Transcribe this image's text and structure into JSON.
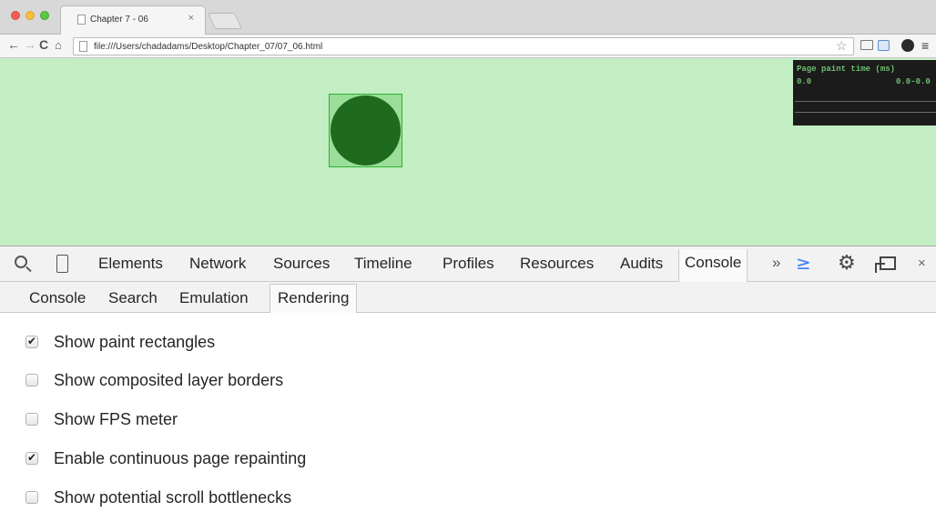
{
  "browser": {
    "tab_title": "Chapter 7 - 06",
    "tab_close": "×",
    "url": "file:///Users/chadadams/Desktop/Chapter_07/07_06.html",
    "nav": {
      "back": "←",
      "forward": "→",
      "reload": "C",
      "home": "⌂"
    },
    "bookmark": "☆",
    "menu": "≡"
  },
  "page": {
    "background": "#c4eec4",
    "fps_hud": {
      "title": "Page paint time (ms)",
      "value": "0.0",
      "range": "0.0-0.0"
    }
  },
  "devtools": {
    "tabs": [
      "Elements",
      "Network",
      "Sources",
      "Timeline",
      "Profiles",
      "Resources",
      "Audits",
      "Console"
    ],
    "active_tab": "Console",
    "more": "»",
    "close": "×",
    "subtabs": [
      "Console",
      "Search",
      "Emulation",
      "Rendering"
    ],
    "active_subtab": "Rendering",
    "options": [
      {
        "label": "Show paint rectangles",
        "checked": true
      },
      {
        "label": "Show composited layer borders",
        "checked": false
      },
      {
        "label": "Show FPS meter",
        "checked": false
      },
      {
        "label": "Enable continuous page repainting",
        "checked": true
      },
      {
        "label": "Show potential scroll bottlenecks",
        "checked": false
      }
    ]
  }
}
